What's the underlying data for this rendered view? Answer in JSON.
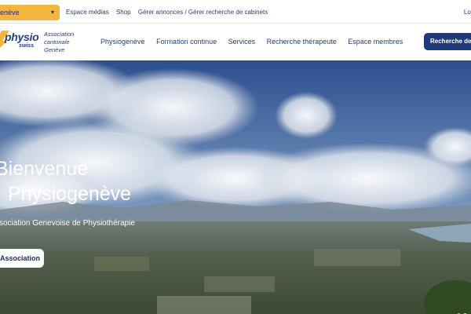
{
  "topbar": {
    "region_label": "enève",
    "links": [
      "Espace médias",
      "Shop",
      "Gérer annonces / Gérer recherche de cabinets"
    ],
    "login": "Logi"
  },
  "logo": {
    "word": "physio",
    "swiss": "swiss",
    "assoc_line1": "Association",
    "assoc_line2": "cantonale",
    "assoc_line3": "Genève"
  },
  "nav": {
    "items": [
      "Physiogenève",
      "Formation continue",
      "Services",
      "Recherche thérapeute",
      "Espace membres"
    ],
    "cta": "Recherche de c"
  },
  "hero": {
    "title_line1": "Bienvenue",
    "title_line2": "Physiogenève",
    "subtitle": "ssociation Genevoise de Physiothérapie",
    "button": "Association"
  },
  "colors": {
    "brand_blue": "#27407f",
    "cta_blue": "#1f3a7a",
    "accent_yellow": "#f3b63c"
  }
}
